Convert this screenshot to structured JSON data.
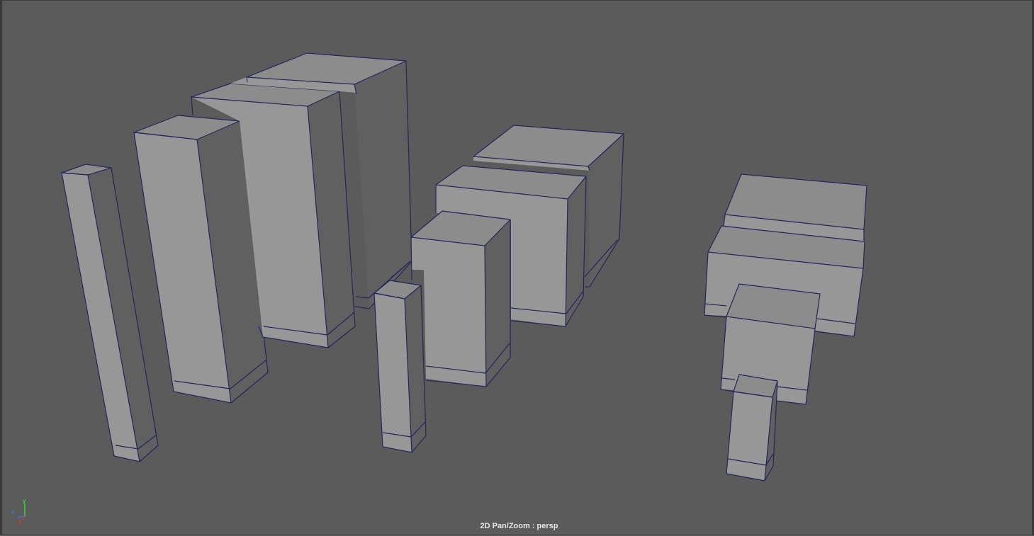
{
  "viewport": {
    "camera_label": "2D Pan/Zoom : persp",
    "background_color": "#5b5b5b",
    "wireframe_color": "#25255a",
    "axis_labels": {
      "x": "x",
      "y": "y",
      "z": "z"
    },
    "axis_colors": {
      "x": "#d23a3a",
      "y": "#3ad23a",
      "z": "#3a78d2"
    }
  }
}
